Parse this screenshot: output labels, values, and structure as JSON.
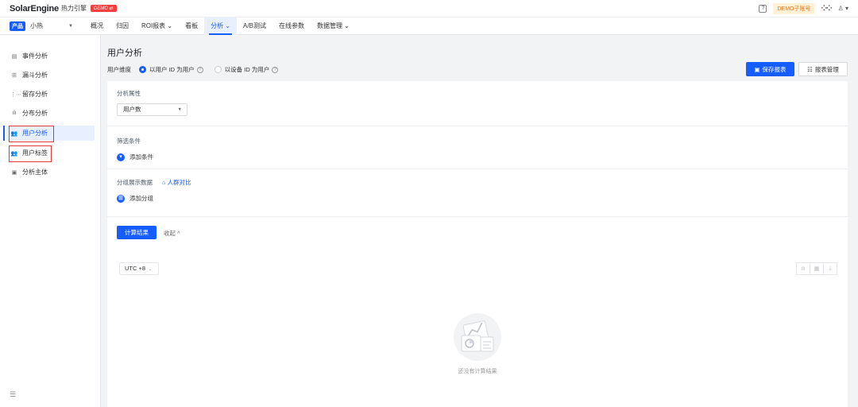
{
  "header": {
    "brand": "SolarEngine",
    "brand_sub": "热力引擎",
    "demo_badge": "DEMO ⇄",
    "help_icon": "?",
    "account": "DEMO子账号",
    "grid_icon": "grid-icon",
    "user_icon": "user-icon"
  },
  "nav": {
    "product_badge": "产品",
    "product_name": "小热",
    "items": [
      "概况",
      "归因",
      "ROI报表 ⌄",
      "看板",
      "分析 ⌄",
      "A/B测试",
      "在线参数",
      "数据管理 ⌄"
    ],
    "active_index": 4
  },
  "sidebar": {
    "items": [
      {
        "icon": "event-analysis-icon",
        "glyph": "▤",
        "label": "事件分析"
      },
      {
        "icon": "funnel-icon",
        "glyph": "☰",
        "label": "漏斗分析"
      },
      {
        "icon": "retention-icon",
        "glyph": "⋮⋯",
        "label": "留存分析"
      },
      {
        "icon": "distribution-icon",
        "glyph": "ılı",
        "label": "分布分析"
      },
      {
        "icon": "user-analysis-icon",
        "glyph": "👥",
        "label": "用户分析"
      },
      {
        "icon": "user-tag-icon",
        "glyph": "👥",
        "label": "用户标签"
      },
      {
        "icon": "analysis-subject-icon",
        "glyph": "▣",
        "label": "分析主体"
      }
    ],
    "active_index": 4,
    "collapse_icon": "☰"
  },
  "page": {
    "title": "用户分析",
    "dimension_label": "用户维度",
    "dimension_options": [
      "以用户 ID 为用户",
      "以设备 ID 为用户"
    ],
    "dimension_selected": 0,
    "save_button": "保存报表",
    "manage_button": "报表管理"
  },
  "panel": {
    "attr_label": "分析属性",
    "attr_value": "用户数",
    "filter_label": "筛选条件",
    "add_condition": "添加条件",
    "group_label": "分组展示数据",
    "crowd_compare": "人群对比",
    "add_group": "添加分组",
    "calc_button": "计算结果",
    "collapse": "收起 ^"
  },
  "result": {
    "timezone": "UTC +8",
    "tools": [
      "chart-icon",
      "table-icon",
      "download-icon"
    ],
    "empty_text": "还没有计算结果"
  }
}
